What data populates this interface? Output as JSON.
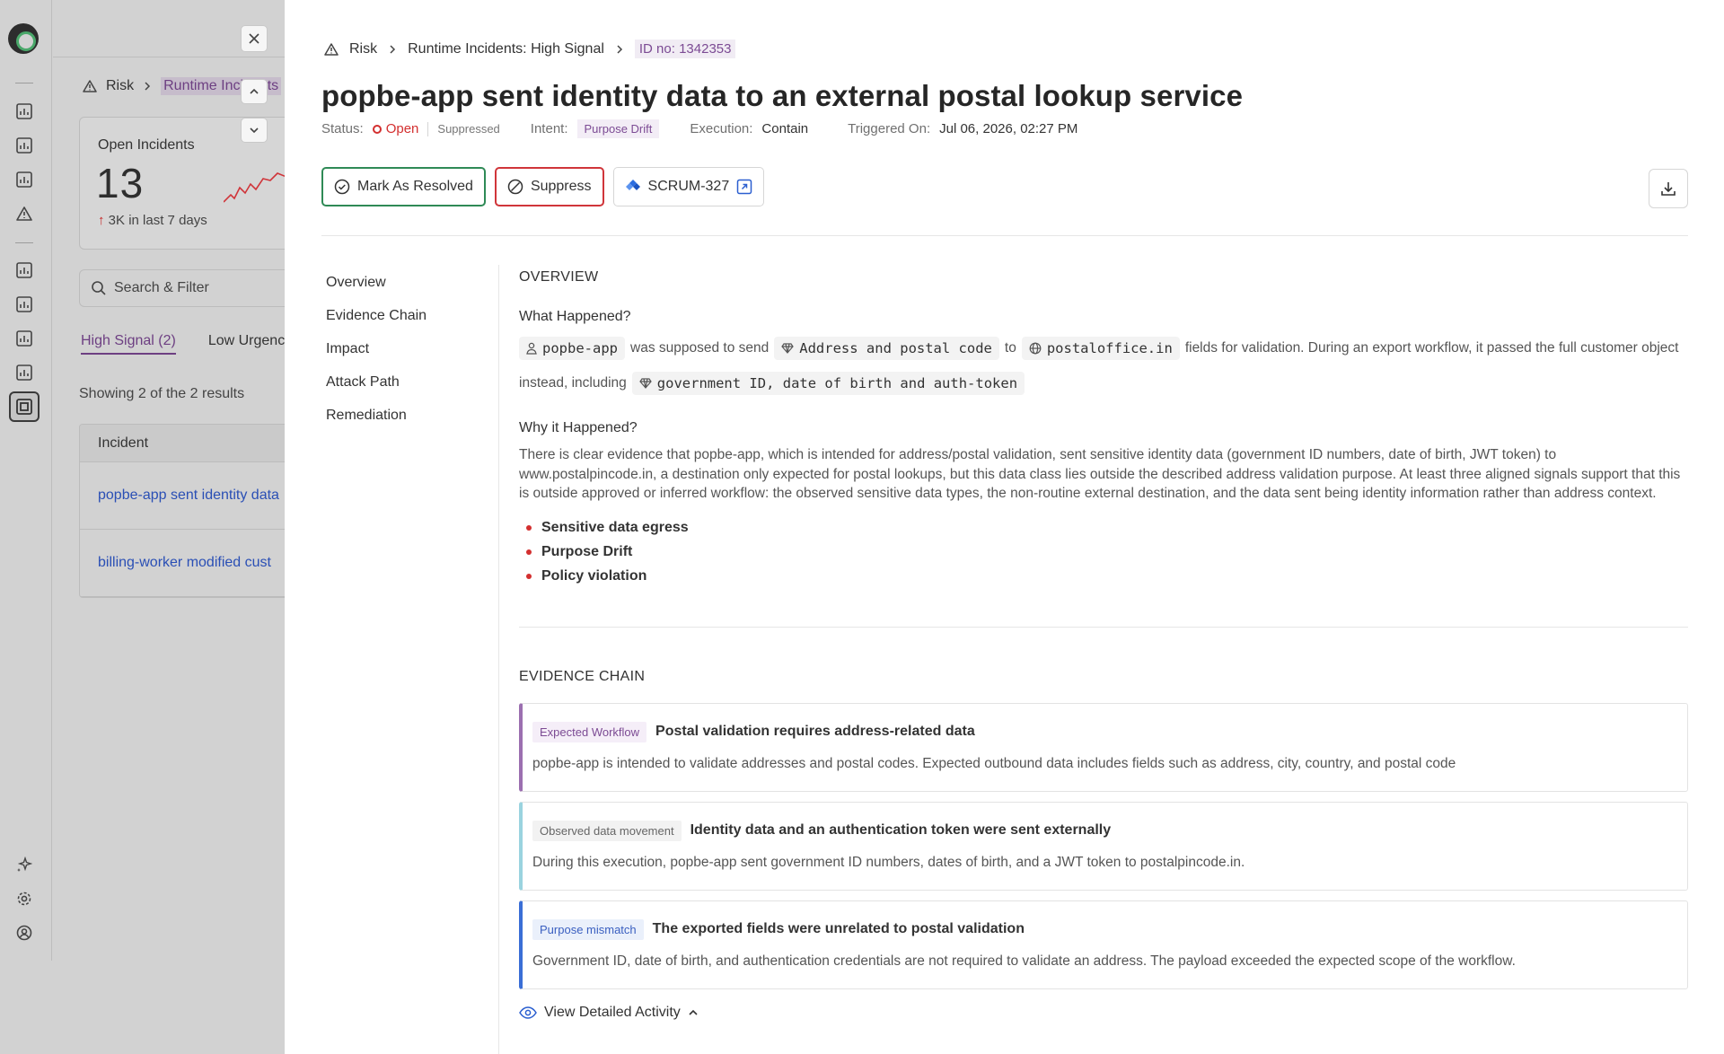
{
  "background_page": {
    "breadcrumb": {
      "root": "Risk",
      "current": "Runtime Incidents"
    },
    "open_incidents": {
      "title": "Open Incidents",
      "count": "13",
      "delta_value": "3K",
      "delta_text": "in last 7 days"
    },
    "search_placeholder": "Search & Filter",
    "tabs": [
      {
        "label": "High Signal (2)"
      },
      {
        "label": "Low Urgency"
      }
    ],
    "showing_text": "Showing 2 of the 2 results",
    "table": {
      "column": "Incident",
      "rows": [
        {
          "title": "popbe-app sent identity data"
        },
        {
          "title": "billing-worker modified cust"
        }
      ]
    }
  },
  "incident": {
    "breadcrumb": {
      "root": "Risk",
      "section": "Runtime Incidents: High Signal",
      "id": "ID no: 1342353"
    },
    "title": "popbe-app sent identity data to an external postal lookup service",
    "meta": {
      "status_label": "Status:",
      "status_value": "Open",
      "suppressed": "Suppressed",
      "intent_label": "Intent:",
      "intent_value": "Purpose Drift",
      "execution_label": "Execution:",
      "execution_value": "Contain",
      "triggered_label": "Triggered On:",
      "triggered_value": "Jul 06, 2026, 02:27 PM"
    },
    "actions": {
      "resolve": "Mark As Resolved",
      "suppress": "Suppress",
      "ticket": "SCRUM-327"
    },
    "nav": [
      "Overview",
      "Evidence Chain",
      "Impact",
      "Attack Path",
      "Remediation"
    ],
    "overview": {
      "heading": "OVERVIEW",
      "what_heading": "What Happened?",
      "what": {
        "actor": "popbe-app",
        "t1": "was supposed to send",
        "data": "Address and postal code",
        "t2": "to",
        "destination": "postaloffice.in",
        "t3": "fields for validation. During an export workflow, it passed the full customer object instead, including",
        "leaked": "government ID, date of birth and auth-token"
      },
      "why_heading": "Why it Happened?",
      "why": "There is clear evidence that popbe-app, which is intended for address/postal validation, sent sensitive identity data (government ID numbers, date of birth, JWT token) to www.postalpincode.in, a destination only expected for postal lookups, but this data class lies outside the described address validation purpose. At least three aligned signals support that this is outside approved or inferred workflow: the observed sensitive data types, the non-routine external destination, and the data sent being identity information rather than address context.",
      "bullets": [
        "Sensitive data egress",
        "Purpose Drift",
        "Policy violation"
      ]
    },
    "evidence_chain": {
      "heading": "EVIDENCE CHAIN",
      "items": [
        {
          "tag": "Expected Workflow",
          "title": "Postal validation requires address-related data",
          "body": "popbe-app is intended to validate addresses and postal codes. Expected outbound data includes fields such as address, city, country, and postal code"
        },
        {
          "tag": "Observed data movement",
          "title": "Identity data and an authentication token were sent externally",
          "body": "During this execution, popbe-app sent government ID numbers, dates of birth, and a JWT token to postalpincode.in."
        },
        {
          "tag": "Purpose mismatch",
          "title": "The exported fields were unrelated to postal validation",
          "body": "Government ID, date of birth, and authentication credentials are not required to validate an address. The payload exceeded the expected scope of the workflow."
        }
      ],
      "view_activity": "View Detailed Activity"
    }
  },
  "colors": {
    "accent_purple": "#7c4b94",
    "status_red": "#d32f2f",
    "resolve_green": "#2f8a56",
    "link_blue": "#2a4fb5"
  }
}
